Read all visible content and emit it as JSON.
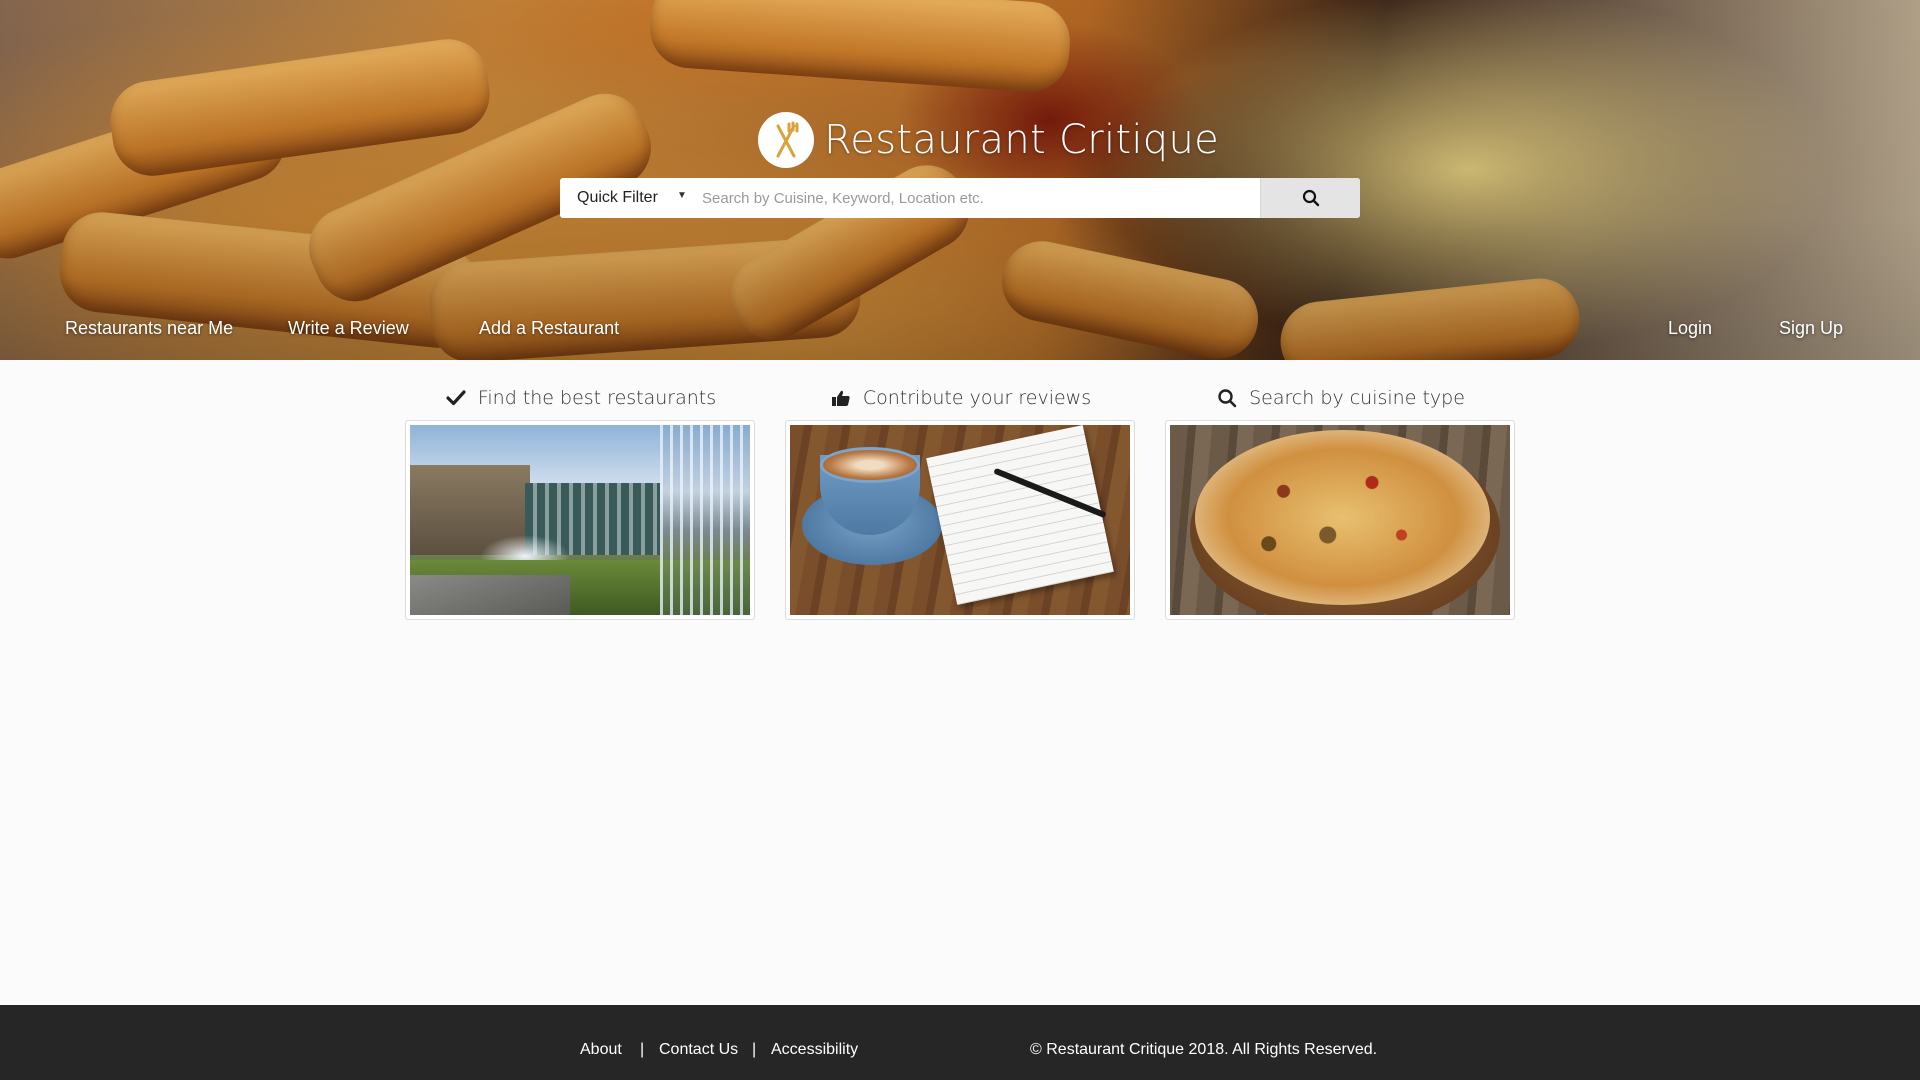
{
  "brand": {
    "name": "Restaurant Critique"
  },
  "search": {
    "filter_label": "Quick Filter",
    "placeholder": "Search by Cuisine, Keyword, Location etc."
  },
  "nav": {
    "left": [
      "Restaurants near Me",
      "Write a Review",
      "Add a Restaurant"
    ],
    "right": [
      "Login",
      "Sign Up"
    ]
  },
  "features": [
    {
      "title": "Find the best restaurants",
      "icon": "check-icon"
    },
    {
      "title": "Contribute your reviews",
      "icon": "thumbs-up-icon"
    },
    {
      "title": "Search by cuisine type",
      "icon": "search-icon"
    }
  ],
  "footer": {
    "links": [
      "About",
      "Contact Us",
      "Accessibility"
    ],
    "separator": "|",
    "copyright": "© Restaurant Critique 2018. All Rights Reserved."
  },
  "colors": {
    "footer_bg": "#262626",
    "page_bg": "#fbfbfb",
    "search_button_bg": "#e4e4e4"
  }
}
